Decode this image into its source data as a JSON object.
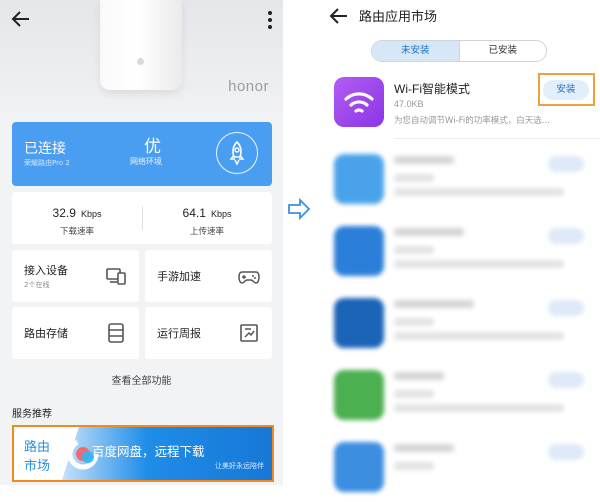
{
  "left": {
    "brand": "honor",
    "status": {
      "title": "已连接",
      "subtitle": "荣耀路由Pro 2",
      "quality": "优",
      "quality_label": "网络环境"
    },
    "speeds": [
      {
        "value": "32.9",
        "unit": "Kbps",
        "label": "下载速率"
      },
      {
        "value": "64.1",
        "unit": "Kbps",
        "label": "上传速率"
      }
    ],
    "tiles": [
      {
        "label": "接入设备",
        "sub": "2个在线",
        "icon": "devices-icon"
      },
      {
        "label": "手游加速",
        "icon": "gamepad-icon"
      },
      {
        "label": "路由存储",
        "icon": "storage-icon"
      },
      {
        "label": "运行周报",
        "icon": "report-icon"
      }
    ],
    "view_all": "查看全部功能",
    "section_title": "服务推荐",
    "banner": {
      "left_line1": "路由",
      "left_line2": "市场",
      "title": "百度网盘，远程下载",
      "subtitle": "让美好永远陪伴"
    }
  },
  "right": {
    "title": "路由应用市场",
    "tabs": [
      {
        "label": "未安装",
        "active": true
      },
      {
        "label": "已安装",
        "active": false
      }
    ],
    "featured_app": {
      "name": "Wi-Fi智能模式",
      "size": "47.0KB",
      "description": "为您自动调节Wi-Fi的功率模式，白天选...",
      "install_label": "安装",
      "icon": "wifi-icon",
      "icon_color": "#9b45ec"
    },
    "blurred_apps": [
      {
        "icon_color": "#4aa3ea"
      },
      {
        "icon_color": "#2b7fd8"
      },
      {
        "icon_color": "#1b64b8"
      },
      {
        "icon_color": "#4caf50"
      },
      {
        "icon_color": "#3c8ee0"
      }
    ]
  },
  "colors": {
    "accent_blue": "#4a9ef1",
    "highlight_orange": "#f08c1e"
  }
}
